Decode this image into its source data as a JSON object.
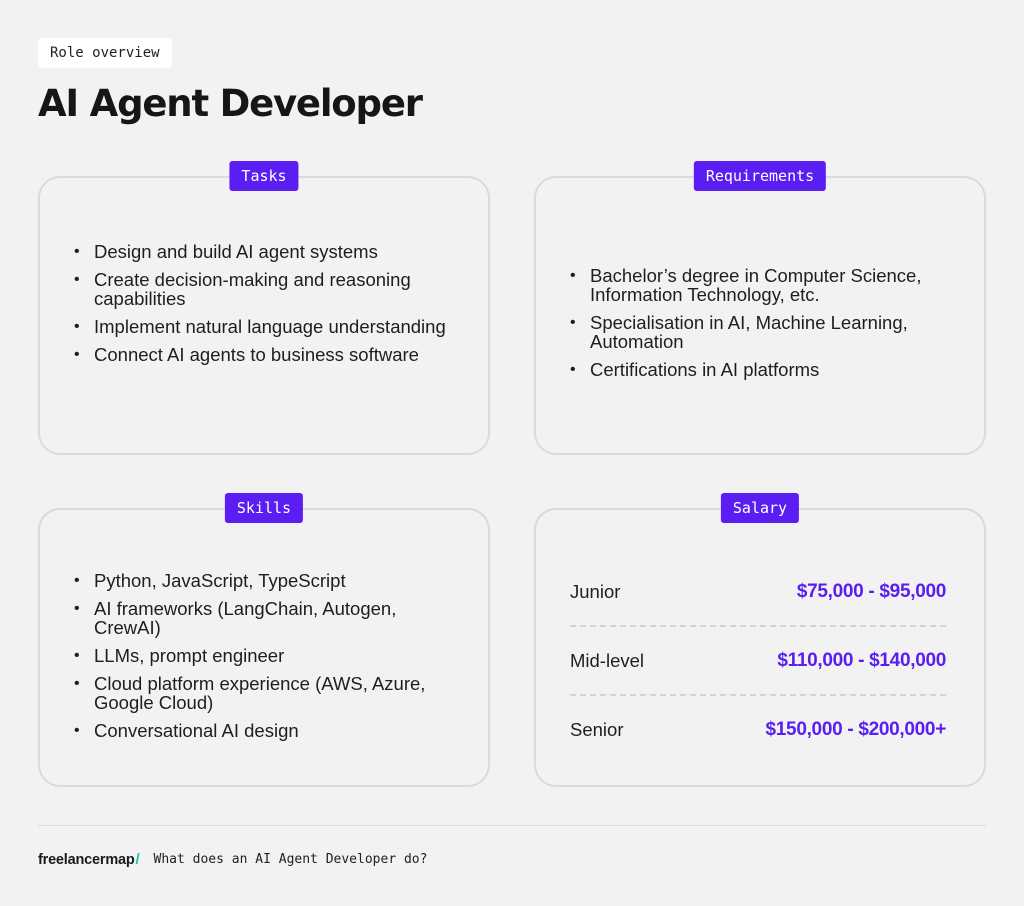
{
  "header": {
    "tag": "Role overview",
    "title": "AI Agent Developer"
  },
  "sections": {
    "tasks": {
      "label": "Tasks",
      "items": [
        "Design and build AI agent systems",
        "Create decision-making and reasoning capabilities",
        "Implement natural language understanding",
        "Connect AI agents to business software"
      ]
    },
    "requirements": {
      "label": "Requirements",
      "items": [
        "Bachelor’s degree in Computer Science, Information Technology, etc.",
        "Specialisation in AI, Machine Learning, Automation",
        "Certifications in AI platforms"
      ]
    },
    "skills": {
      "label": "Skills",
      "items": [
        "Python, JavaScript, TypeScript",
        "AI frameworks (LangChain, Autogen, CrewAI)",
        "LLMs, prompt engineer",
        "Cloud platform experience (AWS, Azure, Google Cloud)",
        "Conversational AI design"
      ]
    },
    "salary": {
      "label": "Salary",
      "rows": [
        {
          "level": "Junior",
          "range": "$75,000 - $95,000"
        },
        {
          "level": "Mid-level",
          "range": "$110,000 - $140,000"
        },
        {
          "level": "Senior",
          "range": "$150,000 - $200,000+"
        }
      ]
    }
  },
  "footer": {
    "brand": "freelancermap",
    "brand_slash": "/",
    "caption": "What does an AI Agent Developer do?"
  },
  "colors": {
    "accent": "#5a1ef2",
    "brand_slash": "#19c6a8",
    "background": "#f2f2f2"
  }
}
